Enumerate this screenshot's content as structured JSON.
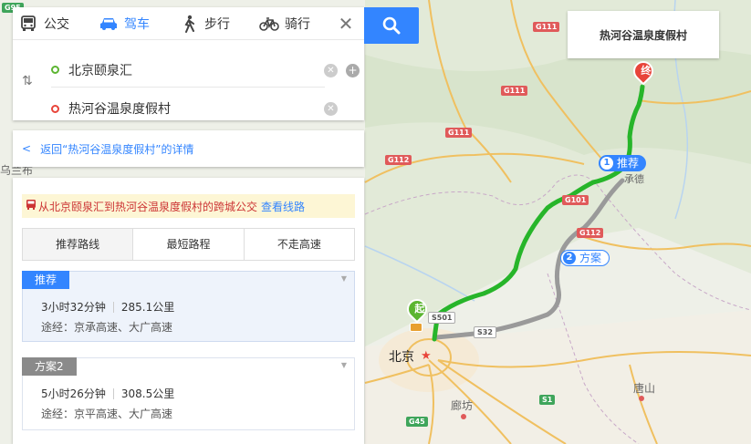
{
  "modes": [
    {
      "label": "公交",
      "icon": "bus-icon",
      "active": false
    },
    {
      "label": "驾车",
      "icon": "car-icon",
      "active": true
    },
    {
      "label": "步行",
      "icon": "walk-icon",
      "active": false
    },
    {
      "label": "骑行",
      "icon": "bike-icon",
      "active": false
    }
  ],
  "search": {
    "start": "北京颐泉汇",
    "end": "热河谷温泉度假村"
  },
  "back_link": "返回“热河谷温泉度假村”的详情",
  "notice": {
    "text": "从北京颐泉汇到热河谷温泉度假村的跨城公交",
    "link": "查看线路"
  },
  "tabs": [
    "推荐路线",
    "最短路程",
    "不走高速"
  ],
  "routes": [
    {
      "badge": "推荐",
      "duration": "3小时32分钟",
      "distance": "285.1公里",
      "via": "途经：京承高速、大广高速"
    },
    {
      "badge": "方案2",
      "duration": "5小时26分钟",
      "distance": "308.5公里",
      "via": "途经：京平高速、大广高速"
    }
  ],
  "map": {
    "destination_label": "热河谷温泉度假村",
    "bubble_primary_num": "1",
    "bubble_primary": "推荐",
    "bubble_alt_num": "2",
    "bubble_alt": "方案",
    "pin_end": "终",
    "pin_start": "起",
    "city_labels": {
      "beijing": "北京",
      "langfang": "廊坊",
      "tangshan": "唐山",
      "wulanbu": "乌兰布",
      "chengde": "承德"
    },
    "road_shields": {
      "g111a": "G111",
      "g111b": "G111",
      "g111c": "G111",
      "g112a": "G112",
      "g112b": "G112",
      "g101": "G101",
      "s32": "S32",
      "s501": "S501",
      "g45": "G45",
      "s1": "S1",
      "g95": "G95"
    },
    "colors": {
      "primary_route": "#27b52a",
      "alt_route": "#a9a9a9",
      "accent": "#3385ff"
    }
  }
}
